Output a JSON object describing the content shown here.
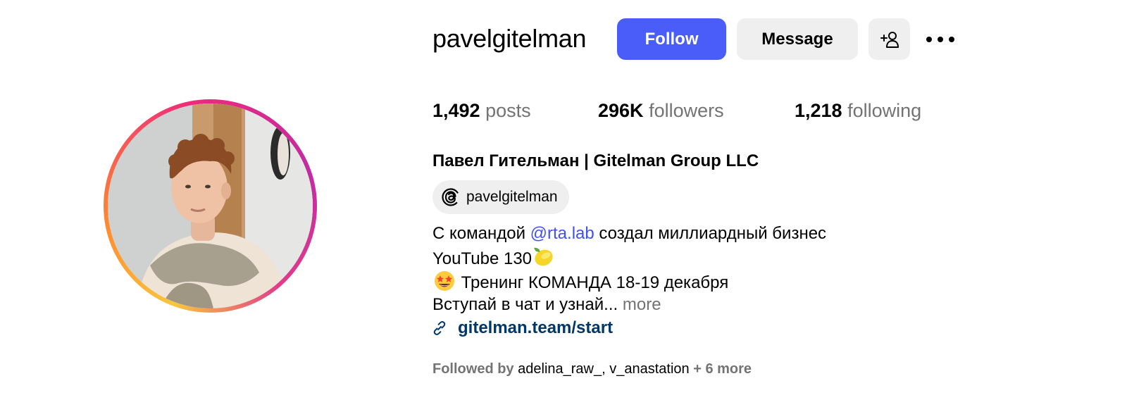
{
  "profile": {
    "username": "pavelgitelman",
    "full_name": "Павел Гительман | Gitelman Group LLC",
    "threads_handle": "pavelgitelman"
  },
  "actions": {
    "follow_label": "Follow",
    "message_label": "Message"
  },
  "stats": {
    "posts_count": "1,492",
    "posts_label": "posts",
    "followers_count": "296K",
    "followers_label": "followers",
    "following_count": "1,218",
    "following_label": "following"
  },
  "bio": {
    "line1_prefix": "С командой",
    "line1_mention": "@rta.lab",
    "line1_suffix": "создал миллиардный бизнес",
    "line2_text": "YouTube 130",
    "line3_text": "Тренинг КОМАНДА 18-19 декабря",
    "line4_text": "Вступай в чат и узнай...",
    "more_label": "more",
    "link_text": "gitelman.team/start"
  },
  "followed_by": {
    "prefix": "Followed by",
    "user1": "adelina_raw_,",
    "user2": "v_anastation",
    "more": "+ 6 more"
  },
  "colors": {
    "follow_button": "#4a5df9",
    "secondary_button": "#efefef",
    "mention": "#4150f7",
    "link": "#00376b",
    "muted_text": "#737373"
  },
  "icons": {
    "add_user": "add-person-icon",
    "more": "more-horizontal-icon",
    "threads": "threads-logo-icon",
    "link": "link-chain-icon"
  }
}
